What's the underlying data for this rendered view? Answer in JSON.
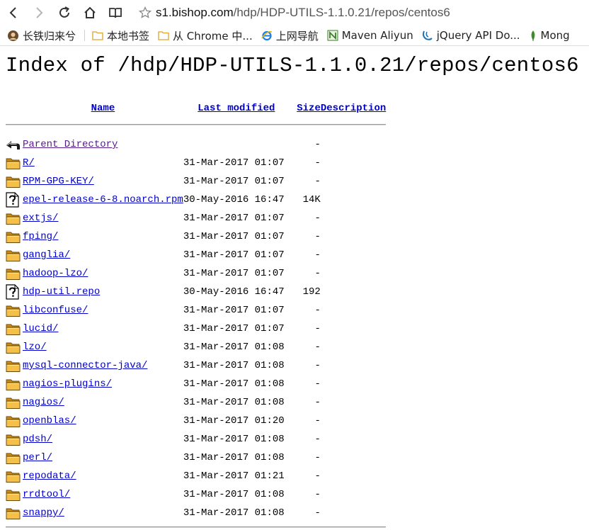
{
  "browser": {
    "url_prefix": "s1.bishop.com",
    "url_path": "/hdp/HDP-UTILS-1.1.0.21/repos/centos6"
  },
  "bookmarks": [
    {
      "label": "长铁归来兮",
      "icon": "avatar-icon"
    },
    {
      "label": "本地书签",
      "icon": "folder-icon"
    },
    {
      "label": "从 Chrome 中...",
      "icon": "folder-icon"
    },
    {
      "label": "上网导航",
      "icon": "ie-icon"
    },
    {
      "label": "Maven Aliyun",
      "icon": "maven-icon"
    },
    {
      "label": "jQuery API Do...",
      "icon": "jquery-icon"
    },
    {
      "label": "Mong",
      "icon": "mongo-leaf-icon"
    }
  ],
  "page": {
    "title": "Index of /hdp/HDP-UTILS-1.1.0.21/repos/centos6",
    "columns": {
      "name": "Name",
      "last_modified": "Last modified",
      "size": "Size",
      "description": "Description"
    },
    "entries": [
      {
        "name": "Parent Directory",
        "modified": "",
        "size": "-",
        "type": "parent"
      },
      {
        "name": "R/",
        "modified": "31-Mar-2017 01:07",
        "size": "-",
        "type": "folder"
      },
      {
        "name": "RPM-GPG-KEY/",
        "modified": "31-Mar-2017 01:07",
        "size": "-",
        "type": "folder"
      },
      {
        "name": "epel-release-6-8.noarch.rpm",
        "modified": "30-May-2016 16:47",
        "size": "14K",
        "type": "file"
      },
      {
        "name": "extjs/",
        "modified": "31-Mar-2017 01:07",
        "size": "-",
        "type": "folder"
      },
      {
        "name": "fping/",
        "modified": "31-Mar-2017 01:07",
        "size": "-",
        "type": "folder"
      },
      {
        "name": "ganglia/",
        "modified": "31-Mar-2017 01:07",
        "size": "-",
        "type": "folder"
      },
      {
        "name": "hadoop-lzo/",
        "modified": "31-Mar-2017 01:07",
        "size": "-",
        "type": "folder"
      },
      {
        "name": "hdp-util.repo",
        "modified": "30-May-2016 16:47",
        "size": "192",
        "type": "file"
      },
      {
        "name": "libconfuse/",
        "modified": "31-Mar-2017 01:07",
        "size": "-",
        "type": "folder"
      },
      {
        "name": "lucid/",
        "modified": "31-Mar-2017 01:07",
        "size": "-",
        "type": "folder"
      },
      {
        "name": "lzo/",
        "modified": "31-Mar-2017 01:08",
        "size": "-",
        "type": "folder"
      },
      {
        "name": "mysql-connector-java/",
        "modified": "31-Mar-2017 01:08",
        "size": "-",
        "type": "folder"
      },
      {
        "name": "nagios-plugins/",
        "modified": "31-Mar-2017 01:08",
        "size": "-",
        "type": "folder"
      },
      {
        "name": "nagios/",
        "modified": "31-Mar-2017 01:08",
        "size": "-",
        "type": "folder"
      },
      {
        "name": "openblas/",
        "modified": "31-Mar-2017 01:20",
        "size": "-",
        "type": "folder"
      },
      {
        "name": "pdsh/",
        "modified": "31-Mar-2017 01:08",
        "size": "-",
        "type": "folder"
      },
      {
        "name": "perl/",
        "modified": "31-Mar-2017 01:08",
        "size": "-",
        "type": "folder"
      },
      {
        "name": "repodata/",
        "modified": "31-Mar-2017 01:21",
        "size": "-",
        "type": "folder"
      },
      {
        "name": "rrdtool/",
        "modified": "31-Mar-2017 01:08",
        "size": "-",
        "type": "folder"
      },
      {
        "name": "snappy/",
        "modified": "31-Mar-2017 01:08",
        "size": "-",
        "type": "folder"
      }
    ]
  },
  "colors": {
    "link": "#0000cc",
    "visited_link": "#551a8b",
    "folder_fill": "#f5c04a"
  }
}
